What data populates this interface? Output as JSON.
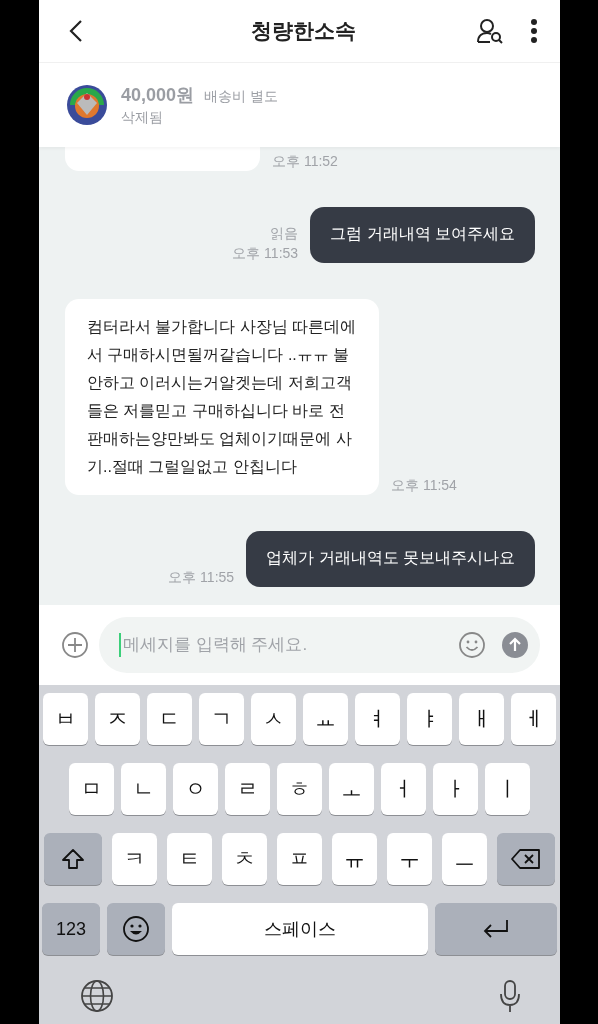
{
  "header": {
    "title": "청량한소속"
  },
  "product": {
    "price": "40,000원",
    "shipping": "배송비 별도",
    "status": "삭제됨"
  },
  "messages": [
    {
      "kind": "incoming",
      "time": "오후 11:52"
    },
    {
      "kind": "outgoing",
      "text": "그럼 거래내역 보여주세요",
      "time": "오후 11:53",
      "read": "읽음"
    },
    {
      "kind": "incoming",
      "text": "컴터라서 불가합니다 사장님 따른데에서 구매하시면될꺼같습니다 ..ㅠㅠ 불안하고 이러시는거알겟는데 저희고객들은 저를믿고 구매하십니다 바로 전 판매하는양만봐도 업체이기때문에 사기..절때 그럴일없고 안칩니다",
      "time": "오후 11:54"
    },
    {
      "kind": "outgoing",
      "text": "업체가 거래내역도 못보내주시나요",
      "time": "오후 11:55"
    }
  ],
  "composer": {
    "placeholder": "메세지를 입력해 주세요."
  },
  "keyboard": {
    "rows": [
      {
        "keys": [
          {
            "kind": "letter",
            "label": "ㅂ"
          },
          {
            "kind": "letter",
            "label": "ㅈ"
          },
          {
            "kind": "letter",
            "label": "ㄷ"
          },
          {
            "kind": "letter",
            "label": "ㄱ"
          },
          {
            "kind": "letter",
            "label": "ㅅ"
          },
          {
            "kind": "letter",
            "label": "ㅛ"
          },
          {
            "kind": "letter",
            "label": "ㅕ"
          },
          {
            "kind": "letter",
            "label": "ㅑ"
          },
          {
            "kind": "letter",
            "label": "ㅐ"
          },
          {
            "kind": "letter",
            "label": "ㅔ"
          }
        ]
      },
      {
        "keys": [
          {
            "kind": "letter",
            "label": "ㅁ"
          },
          {
            "kind": "letter",
            "label": "ㄴ"
          },
          {
            "kind": "letter",
            "label": "ㅇ"
          },
          {
            "kind": "letter",
            "label": "ㄹ"
          },
          {
            "kind": "letter",
            "label": "ㅎ"
          },
          {
            "kind": "letter",
            "label": "ㅗ"
          },
          {
            "kind": "letter",
            "label": "ㅓ"
          },
          {
            "kind": "letter",
            "label": "ㅏ"
          },
          {
            "kind": "letter",
            "label": "ㅣ"
          }
        ]
      },
      {
        "keys": [
          {
            "kind": "shift"
          },
          {
            "kind": "letter",
            "label": "ㅋ"
          },
          {
            "kind": "letter",
            "label": "ㅌ"
          },
          {
            "kind": "letter",
            "label": "ㅊ"
          },
          {
            "kind": "letter",
            "label": "ㅍ"
          },
          {
            "kind": "letter",
            "label": "ㅠ"
          },
          {
            "kind": "letter",
            "label": "ㅜ"
          },
          {
            "kind": "letter",
            "label": "ㅡ"
          },
          {
            "kind": "backspace"
          }
        ]
      },
      {
        "keys": [
          {
            "kind": "mode",
            "label": "123"
          },
          {
            "kind": "emoji"
          },
          {
            "kind": "space",
            "label": "스페이스"
          },
          {
            "kind": "return"
          }
        ]
      }
    ]
  }
}
